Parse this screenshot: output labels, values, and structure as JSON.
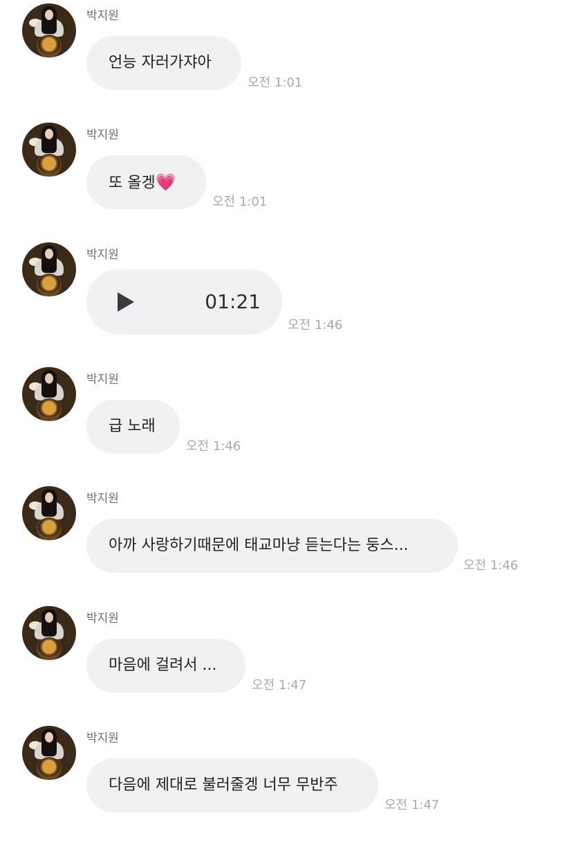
{
  "messages": [
    {
      "sender": "박지원",
      "text": "언능 자러가쟈아",
      "time": "오전 1:01"
    },
    {
      "sender": "박지원",
      "text": "또 올겡",
      "emoji": "💗",
      "time": "오전 1:01"
    },
    {
      "sender": "박지원",
      "voice_duration": "01:21",
      "time": "오전 1:46"
    },
    {
      "sender": "박지원",
      "text": "급 노래",
      "time": "오전 1:46"
    },
    {
      "sender": "박지원",
      "text": "아까 사랑하기때문에 태교마냥 듣는다는 둥스...",
      "time": "오전 1:46"
    },
    {
      "sender": "박지원",
      "text": "마음에 걸려서 ...",
      "time": "오전 1:47"
    },
    {
      "sender": "박지원",
      "text": "다음에 제대로 불러줄겡 너무 무반주",
      "time": "오전 1:47"
    }
  ],
  "colors": {
    "bubble_background": "#f1f1f3",
    "text": "#202024",
    "sender_name": "#6f6f74",
    "timestamp": "#a8a8ad",
    "heart": "#f23fa0"
  },
  "icons": {
    "avatar": "profile-photo-avatar",
    "voice_play": "play-icon",
    "heart_emoji": "heart-icon"
  }
}
